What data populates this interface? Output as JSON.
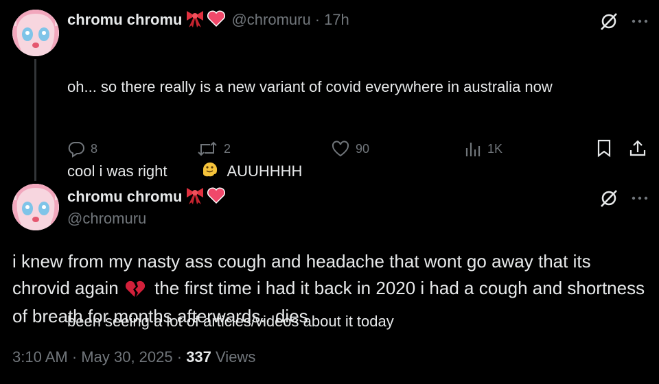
{
  "parent_tweet": {
    "display_name": "chromu chromu",
    "handle": "@chromuru",
    "separator": "·",
    "time": "17h",
    "text_line1": "oh... so there really is a new variant of covid everywhere in australia now",
    "text_line2_pre": "cool i was right ",
    "text_line2_post": " AUUHHHH",
    "text_line3": "been seeing a lot of articles/videos about it today",
    "replies": "8",
    "reposts": "2",
    "likes": "90",
    "views": "1K"
  },
  "main_tweet": {
    "display_name": "chromu chromu",
    "handle": "@chromuru",
    "text_part1": "i knew from my nasty ass cough and headache that wont go away that its chrovid again ",
    "text_part2": " the first time i had it back in 2020 i had a cough and shortness of breath for months afterwards.. dies",
    "time": "3:10 AM",
    "separator": "·",
    "date": "May 30, 2025",
    "separator2": "·",
    "views_count": "337",
    "views_label": "Views"
  },
  "icons": {
    "ribbon": "ribbon-emoji",
    "heart": "heart-emoji",
    "melting_face": "melting-face-emoji",
    "broken_heart": "broken-heart-emoji",
    "grok": "grok-icon",
    "more": "more-icon",
    "reply": "reply-icon",
    "repost": "repost-icon",
    "like": "like-icon",
    "views": "views-icon",
    "bookmark": "bookmark-icon",
    "share": "share-icon"
  },
  "colors": {
    "background": "#000000",
    "text": "#e7e9ea",
    "muted": "#71767b",
    "thread_line": "#333639"
  }
}
